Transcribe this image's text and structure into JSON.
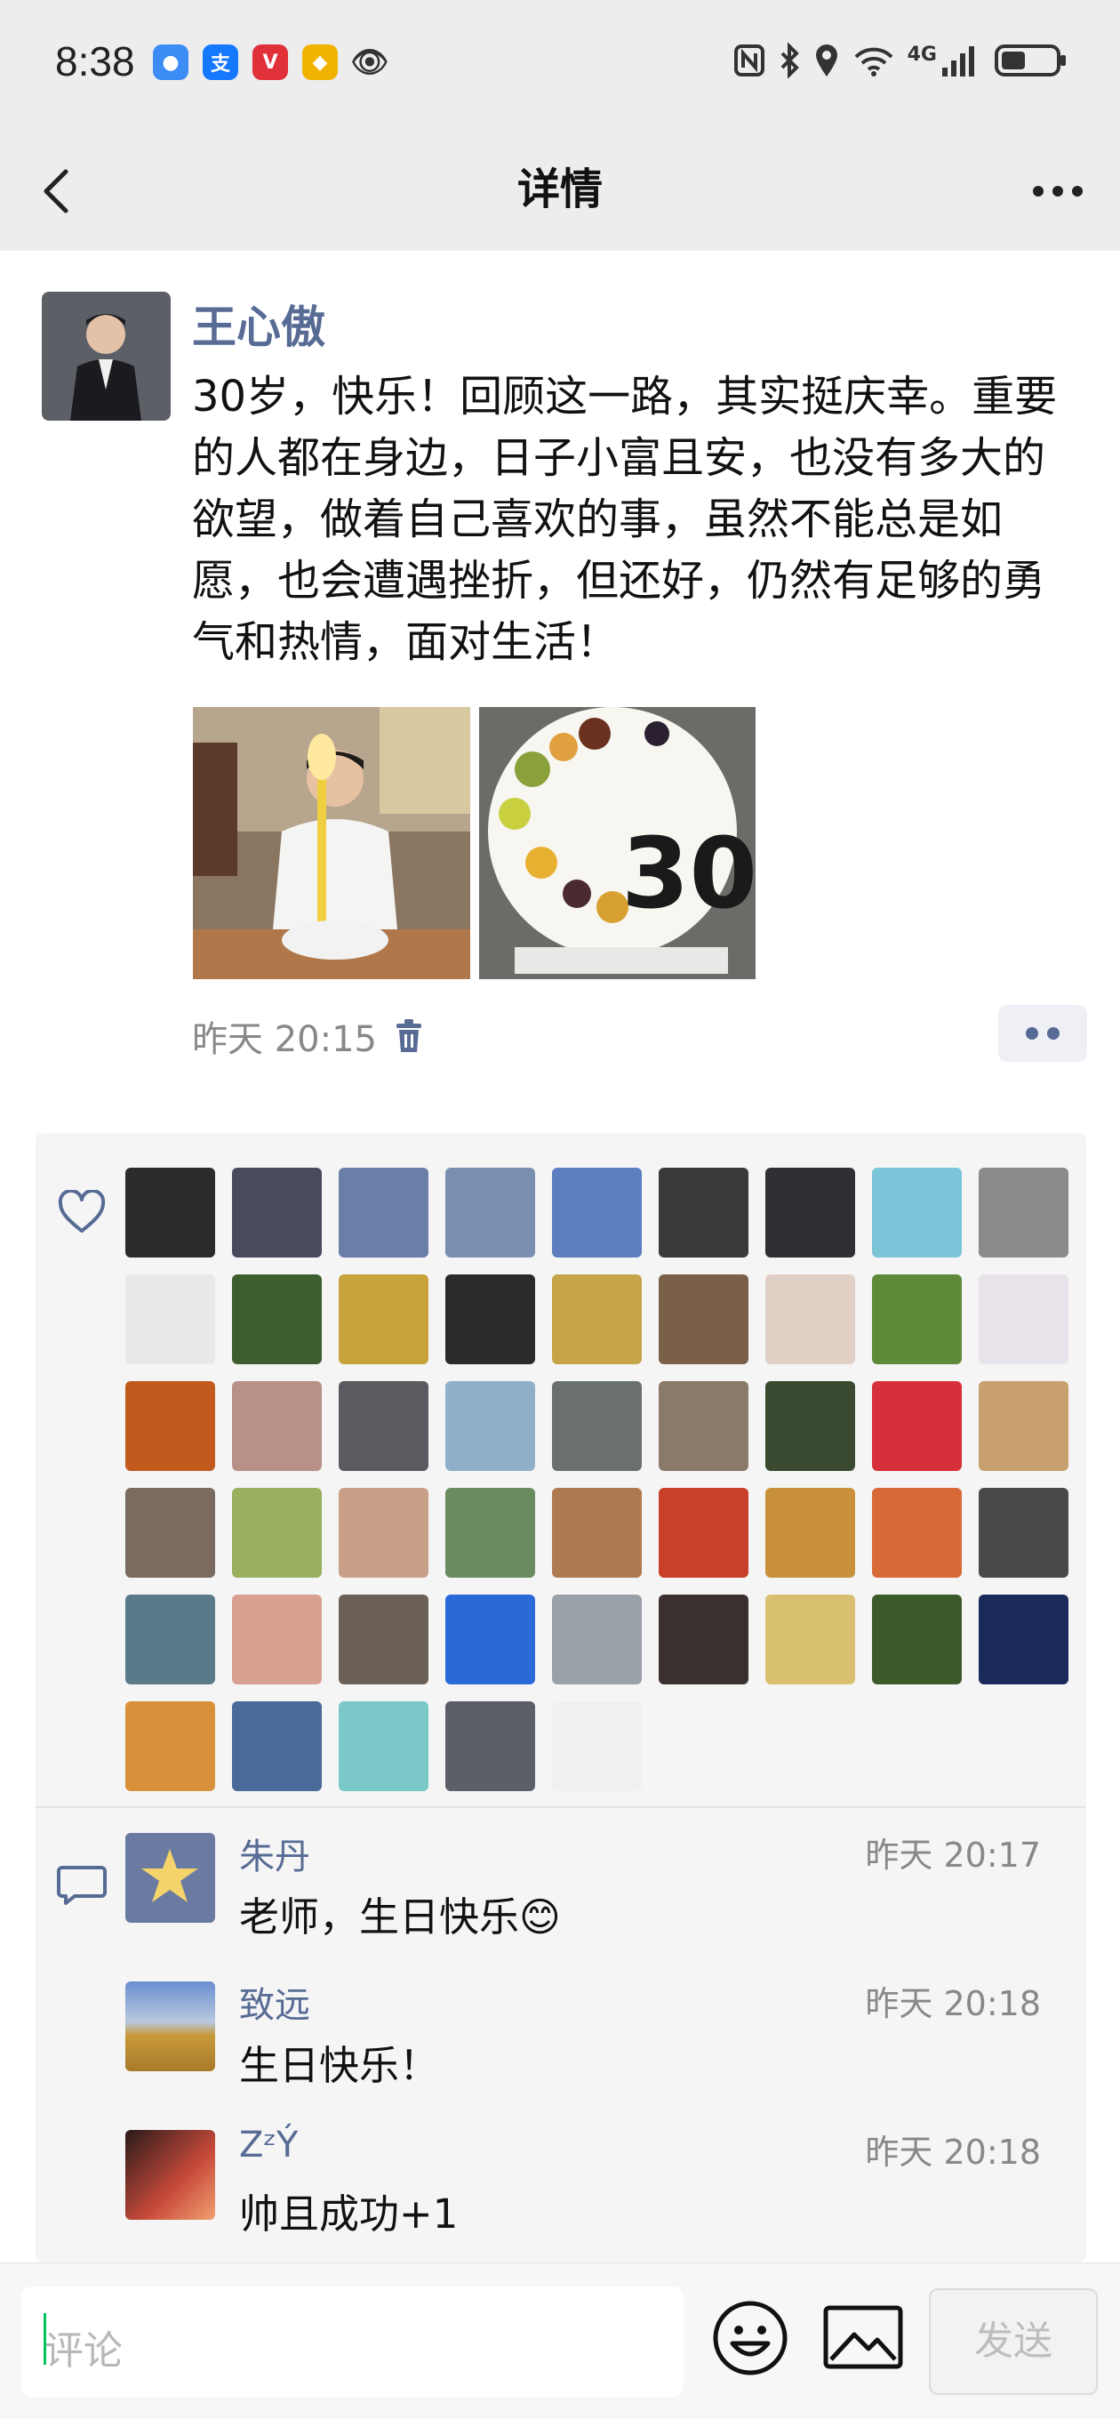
{
  "status_bar": {
    "time": "8:38",
    "network": "4G"
  },
  "nav": {
    "title": "详情"
  },
  "post": {
    "author": "王心傲",
    "text": "30岁，快乐！回顾这一路，其实挺庆幸。重要的人都在身边，日子小富且安，也没有多大的欲望，做着自己喜欢的事，虽然不能总是如愿，也会遭遇挫折，但还好，仍然有足够的勇气和热情，面对生活！",
    "time": "昨天 20:15",
    "photos": [
      {
        "caption_on_photo": ""
      },
      {
        "caption_on_photo": "30"
      }
    ]
  },
  "likes": {
    "count": 50,
    "avatar_colors": [
      "#2b2b2b",
      "#4a4a5e",
      "#6a7fa8",
      "#7a8fb0",
      "#5d7fbf",
      "#3a3a3a",
      "#2f2f35",
      "#7cc5d8",
      "#8a8a8a",
      "#e8e8e8",
      "#3d5e2e",
      "#c8a23a",
      "#2a2a2a",
      "#c6a54a",
      "#7a6048",
      "#e0cfc5",
      "#5f8a3a",
      "#e8e2ea",
      "#c25a1e",
      "#b89088",
      "#5a5a60",
      "#8fb0c8",
      "#6a7070",
      "#8a7a6a",
      "#3a4a30",
      "#d8303a",
      "#c8a070",
      "#7a6a60",
      "#98b060",
      "#c8a088",
      "#6a8a60",
      "#b07a50",
      "#c8402a",
      "#c8903a",
      "#d86a3a",
      "#4a4848",
      "#5a7a8a",
      "#d8a090",
      "#6a6058",
      "#2a6ad8",
      "#9aa0a8",
      "#3a3030",
      "#d8c070",
      "#3a5a2a",
      "#1a2a5a",
      "#d8903a",
      "#4a6a9a",
      "#7ac8c8",
      "#5a5f68",
      "#f0f0f0"
    ]
  },
  "comments": [
    {
      "name": "朱丹",
      "time": "昨天 20:17",
      "text": "老师，生日快乐😊",
      "avatar_color": "#6a7aa0"
    },
    {
      "name": "致远",
      "time": "昨天 20:18",
      "text": "生日快乐！",
      "avatar_color": "#5d7fbf"
    },
    {
      "name": "ZᶻÝ",
      "time": "昨天 20:18",
      "text": "帅且成功+1",
      "avatar_color": "#8a3a2a"
    }
  ],
  "composer": {
    "placeholder": "评论",
    "send_label": "发送"
  }
}
